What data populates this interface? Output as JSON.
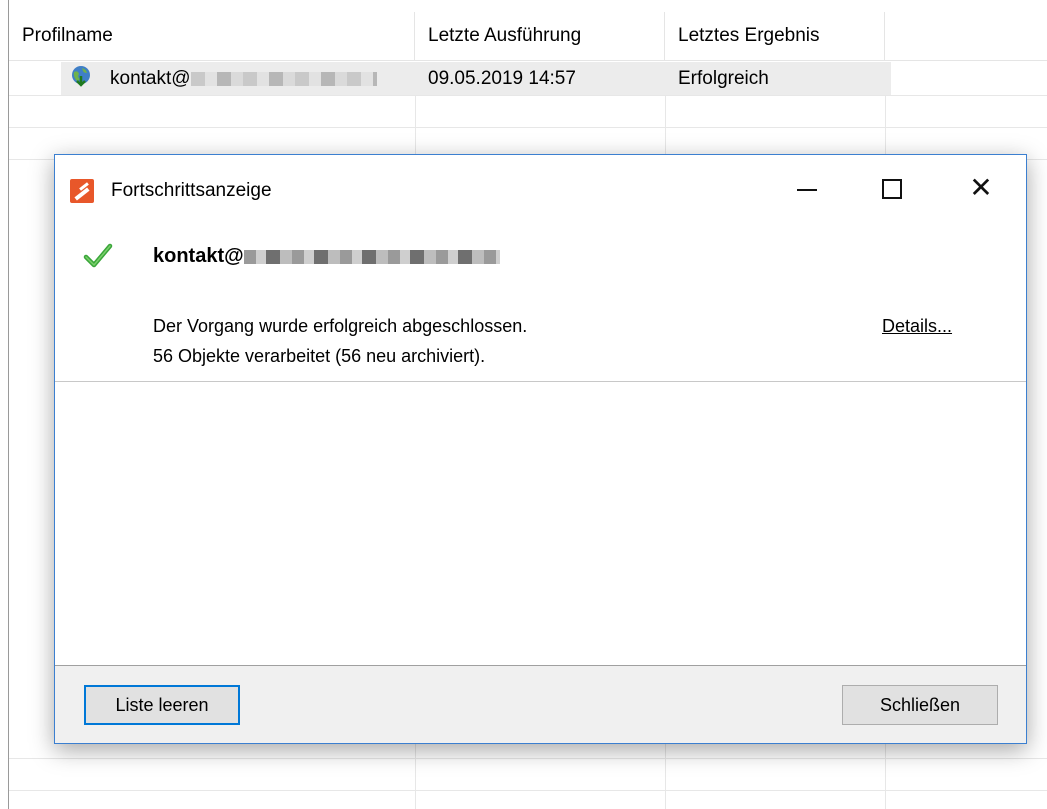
{
  "list": {
    "columns": [
      "Profilname",
      "Letzte Ausführung",
      "Letztes Ergebnis"
    ],
    "rows": [
      {
        "name": "kontakt@",
        "last_run": "09.05.2019 14:57",
        "result": "Erfolgreich"
      }
    ]
  },
  "dialog": {
    "title": "Fortschrittsanzeige",
    "account": "kontakt@",
    "message_line1": "Der Vorgang wurde erfolgreich abgeschlossen.",
    "message_line2": "56 Objekte verarbeitet (56 neu archiviert).",
    "details_link": "Details...",
    "clear_button": "Liste leeren",
    "close_button": "Schließen",
    "window_close_glyph": "✕"
  },
  "colors": {
    "accent": "#0078d7",
    "dialog_border": "#3b7fd0",
    "app_icon": "#e8572a",
    "success": "#3aa63a"
  },
  "icons": {
    "profile": "globe-download-icon",
    "app": "app-logo-icon",
    "status": "checkmark-icon"
  }
}
